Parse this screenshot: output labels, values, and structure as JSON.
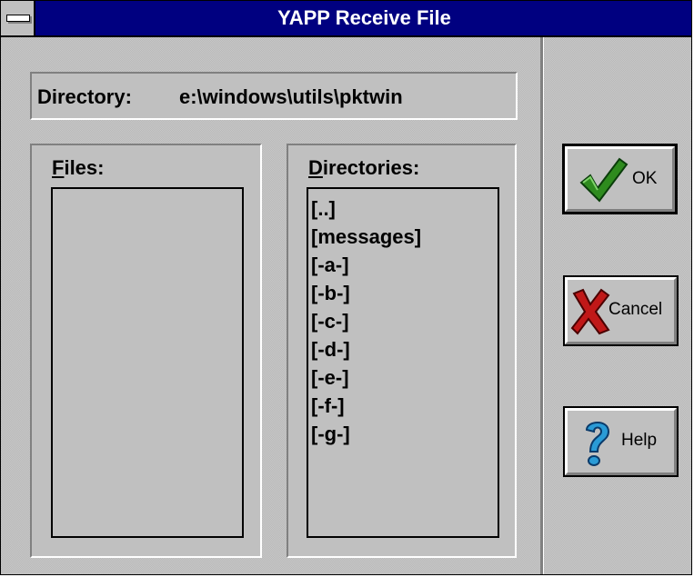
{
  "window": {
    "title": "YAPP Receive File"
  },
  "directory": {
    "label": "Directory:",
    "path": "e:\\windows\\utils\\pktwin"
  },
  "files_panel": {
    "label": "Files:",
    "items": []
  },
  "dirs_panel": {
    "label": "Directories:",
    "items": [
      "[..]",
      "[messages]",
      "[-a-]",
      "[-b-]",
      "[-c-]",
      "[-d-]",
      "[-e-]",
      "[-f-]",
      "[-g-]"
    ]
  },
  "buttons": {
    "ok": "OK",
    "cancel": "Cancel",
    "help": "Help"
  },
  "colors": {
    "titlebar": "#000080",
    "face": "#c0c0c0",
    "check": "#2e8b1e",
    "x_mark": "#c01818",
    "help_q": "#2a9bd6"
  }
}
